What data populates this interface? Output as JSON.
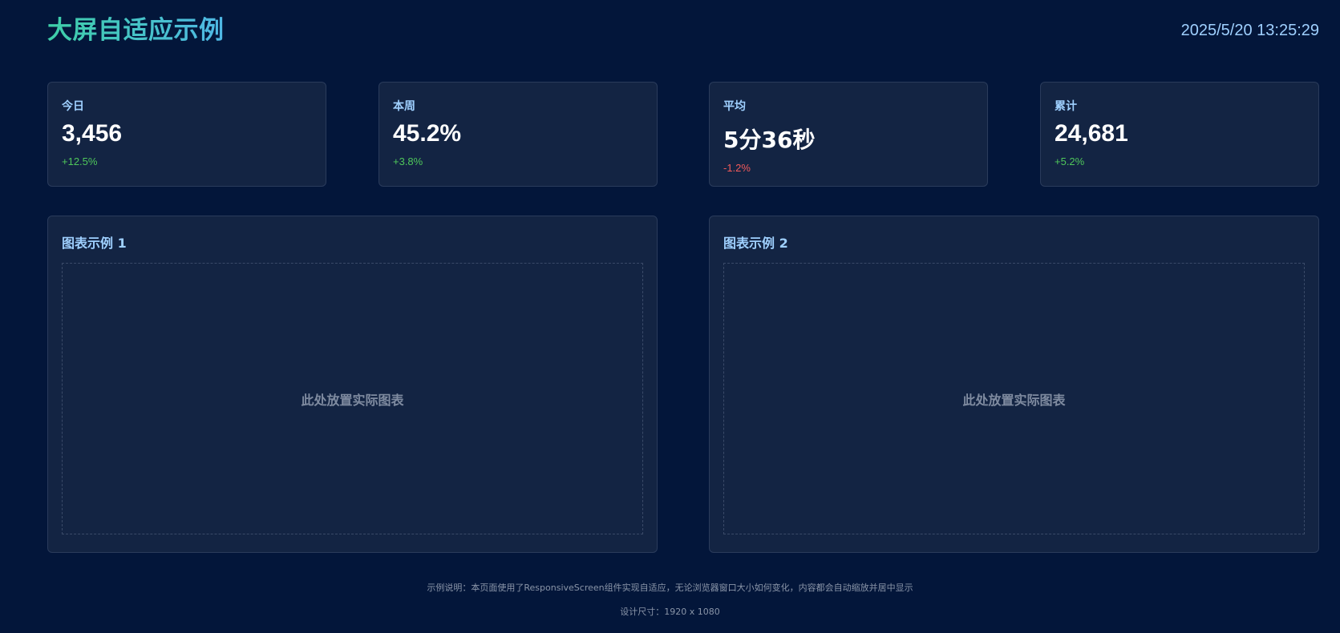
{
  "header": {
    "title": "大屏自适应示例",
    "datetime": "2025/5/20 13:25:29"
  },
  "stats": [
    {
      "label": "今日",
      "value": "3,456",
      "change": "+12.5%",
      "trend": "up"
    },
    {
      "label": "本周",
      "value": "45.2%",
      "change": "+3.8%",
      "trend": "up"
    },
    {
      "label": "平均",
      "value": "5分36秒",
      "change": "-1.2%",
      "trend": "down"
    },
    {
      "label": "累计",
      "value": "24,681",
      "change": "+5.2%",
      "trend": "up"
    }
  ],
  "charts": [
    {
      "title": "图表示例 1",
      "placeholder": "此处放置实际图表"
    },
    {
      "title": "图表示例 2",
      "placeholder": "此处放置实际图表"
    }
  ],
  "footer": {
    "description": "示例说明：本页面使用了ResponsiveScreen组件实现自适应，无论浏览器窗口大小如何变化，内容都会自动缩放并居中显示",
    "design_size": "设计尺寸：1920 x 1080"
  },
  "colors": {
    "background": "#03163a",
    "card": "#132443",
    "accent": "#9fd0ff",
    "up": "#4fc75a",
    "down": "#f25a5a"
  }
}
